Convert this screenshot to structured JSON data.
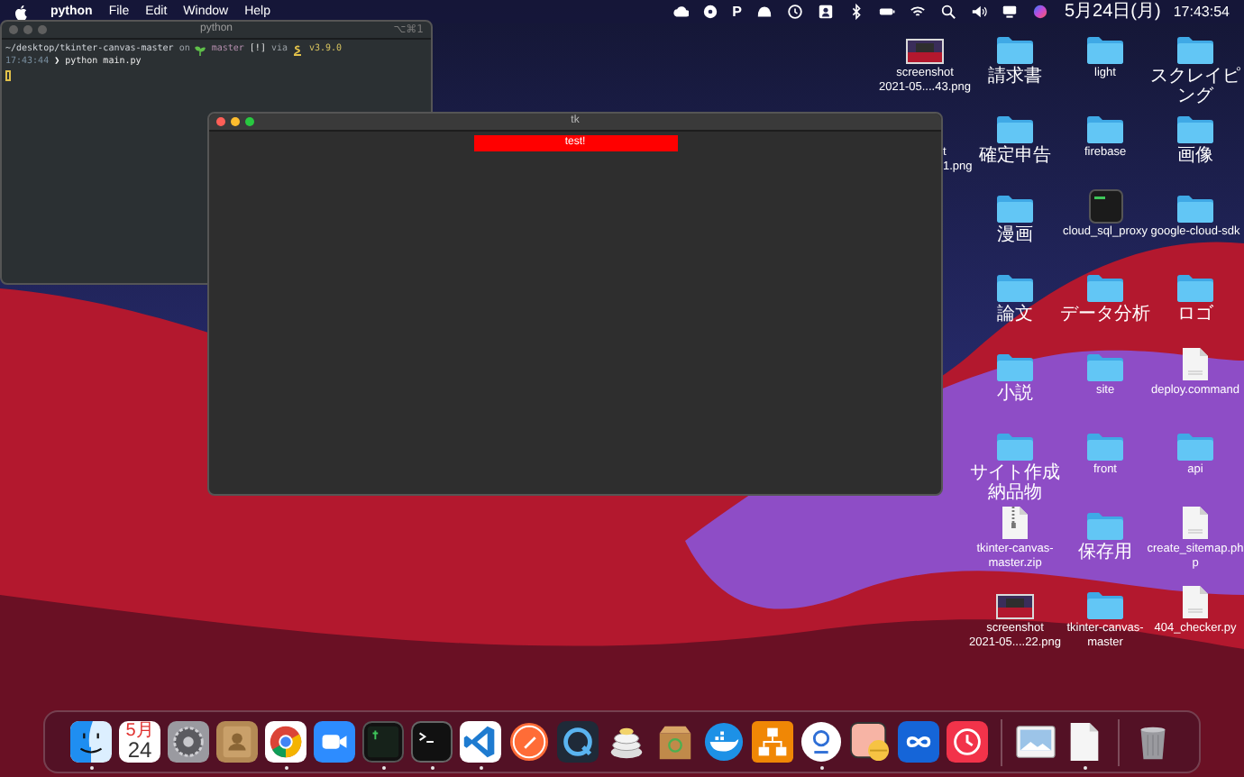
{
  "menu_bar": {
    "app": "python",
    "menus": [
      "File",
      "Edit",
      "Window",
      "Help"
    ],
    "status_letter": "P",
    "date": "5月24日(月)",
    "time": "17:43:54"
  },
  "terminal_window": {
    "title": "python",
    "shortcut": "⌥⌘1",
    "lines": [
      {
        "segments": [
          {
            "kind": "path",
            "text": "~/desktop/tkinter-canvas-master"
          },
          {
            "kind": "plain",
            "text": "on"
          },
          {
            "kind": "branch",
            "text": "master"
          },
          {
            "kind": "status",
            "text": "[!]"
          },
          {
            "kind": "plain",
            "text": "via"
          },
          {
            "kind": "version",
            "text": "v3.9.0"
          }
        ]
      },
      {
        "segments": [
          {
            "kind": "time",
            "text": "17:43:44"
          },
          {
            "kind": "prompt",
            "text": "❯"
          },
          {
            "kind": "command",
            "text": "python main.py"
          }
        ]
      }
    ]
  },
  "tk_window": {
    "title": "tk",
    "label": "test!"
  },
  "desktop": {
    "columns": [
      {
        "items": [
          {
            "kind": "image",
            "label": "screenshot\n2021-05....43.png"
          },
          {
            "kind": "covered",
            "label": "t\n1.png"
          }
        ]
      },
      {
        "items": [
          {
            "kind": "folder",
            "label": "請求書"
          },
          {
            "kind": "folder",
            "label": "確定申告"
          },
          {
            "kind": "folder",
            "label": "漫画"
          },
          {
            "kind": "folder",
            "label": "論文"
          },
          {
            "kind": "folder",
            "label": "小説"
          },
          {
            "kind": "folder",
            "label": "サイト作成納品物"
          },
          {
            "kind": "zip",
            "label": "tkinter-canvas-\nmaster.zip"
          },
          {
            "kind": "image",
            "label": "screenshot\n2021-05....22.png"
          }
        ]
      },
      {
        "items": [
          {
            "kind": "folder",
            "label": "light"
          },
          {
            "kind": "folder",
            "label": "firebase"
          },
          {
            "kind": "exec",
            "label": "cloud_sql_proxy"
          },
          {
            "kind": "folder",
            "label": "データ分析"
          },
          {
            "kind": "folder",
            "label": "site"
          },
          {
            "kind": "folder",
            "label": "front"
          },
          {
            "kind": "folder",
            "label": "保存用"
          },
          {
            "kind": "folder",
            "label": "tkinter-canvas-\nmaster"
          }
        ]
      },
      {
        "items": [
          {
            "kind": "folder",
            "label": "スクレイピング"
          },
          {
            "kind": "folder",
            "label": "画像"
          },
          {
            "kind": "folder",
            "label": "google-cloud-sdk"
          },
          {
            "kind": "folder",
            "label": "ロゴ"
          },
          {
            "kind": "file",
            "label": "deploy.command"
          },
          {
            "kind": "folder",
            "label": "api"
          },
          {
            "kind": "file",
            "label": "create_sitemap.ph\np"
          },
          {
            "kind": "file",
            "label": "404_checker.py"
          }
        ]
      }
    ]
  },
  "dock": {
    "items": [
      {
        "kind": "finder",
        "running": true
      },
      {
        "kind": "calendar",
        "running": false,
        "month": "5月",
        "day": "24"
      },
      {
        "kind": "settings",
        "running": false
      },
      {
        "kind": "contacts",
        "running": false
      },
      {
        "kind": "browser",
        "running": true
      },
      {
        "kind": "video",
        "running": false
      },
      {
        "kind": "terminal-green",
        "running": true
      },
      {
        "kind": "terminal",
        "running": true
      },
      {
        "kind": "code",
        "running": true
      },
      {
        "kind": "rocket",
        "running": false
      },
      {
        "kind": "player",
        "running": false
      },
      {
        "kind": "disks",
        "running": false
      },
      {
        "kind": "box",
        "running": false
      },
      {
        "kind": "whale",
        "running": false
      },
      {
        "kind": "diagram",
        "running": false
      },
      {
        "kind": "ring",
        "running": true
      },
      {
        "kind": "pill",
        "running": false
      },
      {
        "kind": "infinity",
        "running": false
      },
      {
        "kind": "clock",
        "running": false
      },
      {
        "kind": "separator"
      },
      {
        "kind": "picture",
        "running": false
      },
      {
        "kind": "document",
        "running": true
      },
      {
        "kind": "separator"
      },
      {
        "kind": "trash",
        "running": false
      }
    ]
  }
}
